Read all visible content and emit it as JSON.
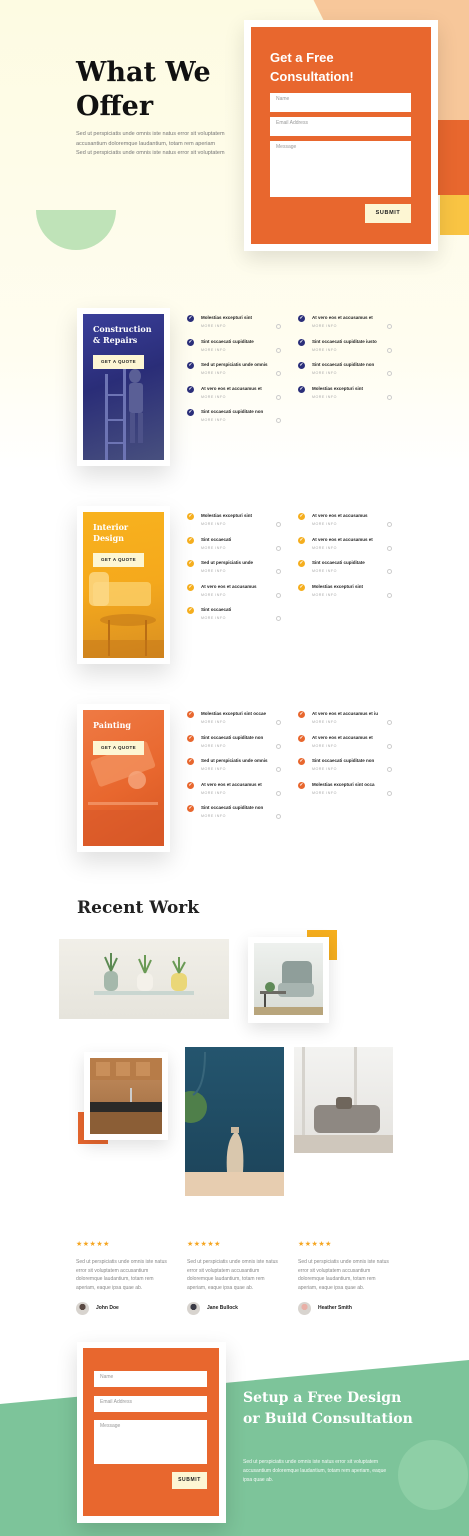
{
  "hero": {
    "title": "What We Offer",
    "text": "Sed ut perspiciatis unde omnis iste natus error sit voluptatem accusantium doloremque laudantium, totam rem aperiam Sed ut perspiciatis unde omnis iste natus error sit voluptatem",
    "form": {
      "title": "Get a Free Consultation!",
      "name_placeholder": "Name",
      "email_placeholder": "Email Address",
      "message_placeholder": "Message",
      "submit_label": "SUBMIT"
    }
  },
  "services": [
    {
      "title": "Construction & Repairs",
      "button": "GET A QUOTE",
      "accent": "#2b2f7a",
      "items": [
        {
          "title": "Molestias excepturi sint",
          "more": "MORE INFO"
        },
        {
          "title": "Sint occaecati cupiditate",
          "more": "MORE INFO"
        },
        {
          "title": "Sed ut perspiciatis unde omnis",
          "more": "MORE INFO"
        },
        {
          "title": "At vero eos et accusamus et",
          "more": "MORE INFO"
        },
        {
          "title": "Sint occaecati cupiditate non",
          "more": "MORE INFO"
        },
        {
          "title": "At vero eos et accusamus et",
          "more": "MORE INFO"
        },
        {
          "title": "Sint occaecati cupiditate iusto",
          "more": "MORE INFO"
        },
        {
          "title": "Sint occaecati cupiditate non",
          "more": "MORE INFO"
        },
        {
          "title": "Molestias excepturi sint",
          "more": "MORE INFO"
        }
      ]
    },
    {
      "title": "Interior Design",
      "button": "GET A QUOTE",
      "accent": "#f5ae1e",
      "items": [
        {
          "title": "Molestias excepturi sint",
          "more": "MORE INFO"
        },
        {
          "title": "Sint occaecati",
          "more": "MORE INFO"
        },
        {
          "title": "Sed ut perspiciatis unde",
          "more": "MORE INFO"
        },
        {
          "title": "At vero eos et accusamus",
          "more": "MORE INFO"
        },
        {
          "title": "Sint occaecati",
          "more": "MORE INFO"
        },
        {
          "title": "At vero eos et accusamus",
          "more": "MORE INFO"
        },
        {
          "title": "At vero eos et accusamus et",
          "more": "MORE INFO"
        },
        {
          "title": "Sint occaecati cupiditate",
          "more": "MORE INFO"
        },
        {
          "title": "Molestias excepturi sint",
          "more": "MORE INFO"
        }
      ]
    },
    {
      "title": "Painting",
      "button": "GET A QUOTE",
      "accent": "#e8672e",
      "items": [
        {
          "title": "Molestias excepturi sint occae",
          "more": "MORE INFO"
        },
        {
          "title": "Sint occaecati cupiditate non",
          "more": "MORE INFO"
        },
        {
          "title": "Sed ut perspiciatis unde omnis",
          "more": "MORE INFO"
        },
        {
          "title": "At vero eos et accusamus et",
          "more": "MORE INFO"
        },
        {
          "title": "Sint occaecati cupiditate non",
          "more": "MORE INFO"
        },
        {
          "title": "At vero eos et accusamus et iu",
          "more": "MORE INFO"
        },
        {
          "title": "At vero eos et accusamus et",
          "more": "MORE INFO"
        },
        {
          "title": "Sint occaecati cupiditate non",
          "more": "MORE INFO"
        },
        {
          "title": "Molestias excepturi sint occa",
          "more": "MORE INFO"
        }
      ]
    }
  ],
  "recent_work": {
    "title": "Recent Work"
  },
  "testimonials": [
    {
      "stars": "★★★★★",
      "text": "Sed ut perspiciatis unde omnis iste natus error sit voluptatem accusantium doloremque laudantium, totam rem aperiam, eaque ipsa quae ab.",
      "name": "John Doe"
    },
    {
      "stars": "★★★★★",
      "text": "Sed ut perspiciatis unde omnis iste natus error sit voluptatem accusantium doloremque laudantium, totam rem aperiam, eaque ipsa quae ab.",
      "name": "Jane Bullock"
    },
    {
      "stars": "★★★★★",
      "text": "Sed ut perspiciatis unde omnis iste natus error sit voluptatem accusantium doloremque laudantium, totam rem aperiam, eaque ipsa quae ab.",
      "name": "Heather Smith"
    }
  ],
  "consult": {
    "title": "Setup a Free Design or Build Consultation",
    "text": "Sed ut perspiciatis unde omnis iste natus error sit voluptatem accusantium doloremque laudantium, totam rem aperiam, eaque ipsa quae ab.",
    "name_placeholder": "Name",
    "email_placeholder": "Email Address",
    "message_placeholder": "Message",
    "submit_label": "SUBMIT"
  },
  "icons": {
    "check": "check-icon",
    "arrow": "circle-arrow-icon",
    "star": "star-icon"
  }
}
